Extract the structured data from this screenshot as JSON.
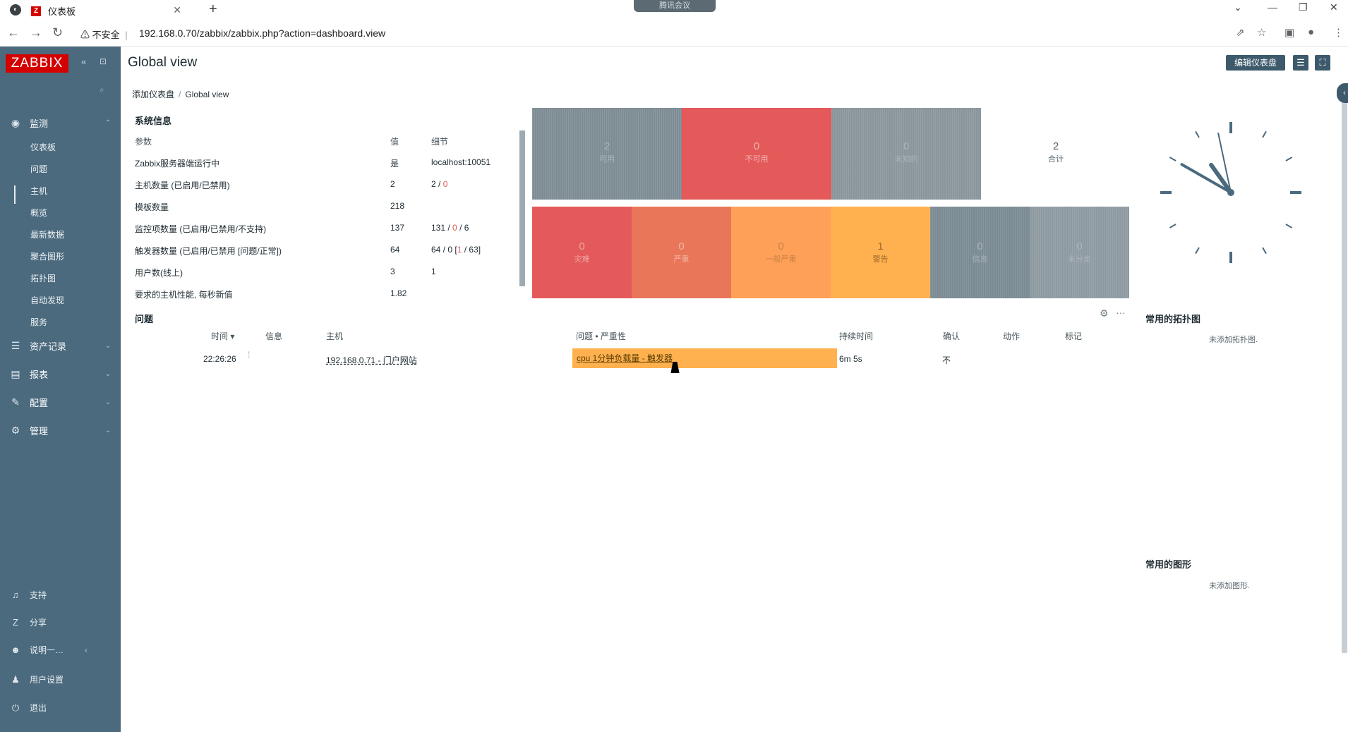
{
  "browser": {
    "tab_title": "仪表板",
    "tab_favicon": "Z",
    "meeting_label": "腾讯会议",
    "address_warning": "不安全",
    "url": "192.168.0.70/zabbix/zabbix.php?action=dashboard.view"
  },
  "sidebar": {
    "logo": "ZABBIX",
    "menu": [
      {
        "label": "监测",
        "icon": "eye-icon"
      },
      {
        "label": "资产记录",
        "icon": "list-icon"
      },
      {
        "label": "报表",
        "icon": "report-icon"
      },
      {
        "label": "配置",
        "icon": "wrench-icon"
      },
      {
        "label": "管理",
        "icon": "gear-icon"
      }
    ],
    "submenu": [
      "仪表板",
      "问题",
      "主机",
      "概览",
      "最新数据",
      "聚合图形",
      "拓扑图",
      "自动发现",
      "服务"
    ],
    "footer": [
      {
        "label": "支持",
        "icon": "headset-icon"
      },
      {
        "label": "分享",
        "icon": "share-icon"
      },
      {
        "label": "说明一…",
        "icon": "help-icon"
      },
      {
        "label": "用户设置",
        "icon": "user-icon"
      },
      {
        "label": "退出",
        "icon": "power-icon"
      }
    ]
  },
  "header": {
    "title": "Global view",
    "edit_button": "编辑仪表盘"
  },
  "breadcrumb": {
    "parent": "添加仪表盘",
    "separator": "/",
    "current": "Global view"
  },
  "system_info": {
    "title": "系统信息",
    "columns": [
      "参数",
      "值",
      "细节"
    ],
    "rows": [
      {
        "param": "Zabbix服务器端运行中",
        "value": "是",
        "detail": "localhost:10051"
      },
      {
        "param": "主机数量 (已启用/已禁用)",
        "value": "2",
        "detail_a": "2",
        "detail_b": "0"
      },
      {
        "param": "模板数量",
        "value": "218"
      },
      {
        "param": "监控项数量 (已启用/已禁用/不支持)",
        "value": "137",
        "detail_a": "131",
        "detail_b": "0",
        "detail_c": "6"
      },
      {
        "param": "触发器数量 (已启用/已禁用 [问题/正常])",
        "value": "64",
        "detail_a": "64 / 0 [",
        "detail_b": "1",
        "detail_c": " / 63]"
      },
      {
        "param": "用户数(线上)",
        "value": "3",
        "detail": "1"
      },
      {
        "param": "要求的主机性能, 每秒新值",
        "value": "1.82"
      }
    ]
  },
  "host_availability": [
    {
      "count": "2",
      "label": "可用",
      "color": "#7e8c94"
    },
    {
      "count": "0",
      "label": "不可用",
      "color": "#e45959"
    },
    {
      "count": "0",
      "label": "未知的",
      "color": "#8a969c"
    },
    {
      "count": "2",
      "label": "合计",
      "color": "#ffffff"
    }
  ],
  "problem_severity": [
    {
      "count": "0",
      "label": "灾难",
      "color": "#e45959"
    },
    {
      "count": "0",
      "label": "严重",
      "color": "#e97659"
    },
    {
      "count": "0",
      "label": "一般严重",
      "color": "#ffa059"
    },
    {
      "count": "1",
      "label": "警告",
      "color": "#ffb14f"
    },
    {
      "count": "0",
      "label": "信息",
      "color": "#7b8b94"
    },
    {
      "count": "0",
      "label": "未分类",
      "color": "#8e9aa1"
    }
  ],
  "problems": {
    "title": "问题",
    "columns": {
      "time": "时间",
      "info": "信息",
      "host": "主机",
      "problem": "问题 • 严重性",
      "duration": "持续时间",
      "ack": "确认",
      "actions": "动作",
      "tags": "标记"
    },
    "rows": [
      {
        "time": "22:26:26",
        "host": "192.168.0.71 - 门户网站",
        "problem": "cpu 1分钟负载量 - 触发器",
        "duration": "6m 5s",
        "ack": "不"
      }
    ]
  },
  "favorite_maps": {
    "title": "常用的拓扑图",
    "empty": "未添加拓扑图."
  },
  "favorite_graphs": {
    "title": "常用的图形",
    "empty": "未添加图形."
  },
  "clock": {
    "hour": 10,
    "minute": 49,
    "second": 58
  }
}
